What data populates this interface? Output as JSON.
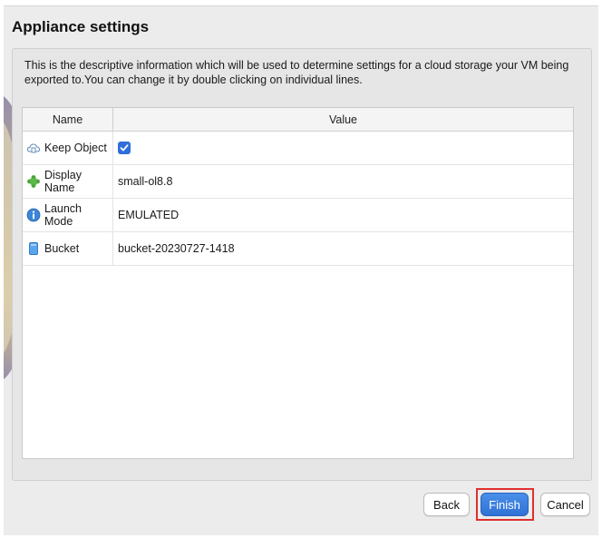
{
  "dialog": {
    "title": "Appliance settings",
    "description": "This is the descriptive information which will be used to determine settings for a cloud storage your VM being exported to.You can change it by double clicking on individual lines."
  },
  "table": {
    "columns": [
      "Name",
      "Value"
    ],
    "rows": [
      {
        "name": "Keep Object",
        "value": "",
        "icon": "cloud-object-icon",
        "checked": true
      },
      {
        "name": "Display Name",
        "value": "small-ol8.8",
        "icon": "puzzle-icon"
      },
      {
        "name": "Launch Mode",
        "value": "EMULATED",
        "icon": "info-icon"
      },
      {
        "name": "Bucket",
        "value": "bucket-20230727-1418",
        "icon": "bucket-icon"
      }
    ]
  },
  "buttons": {
    "back": "Back",
    "finish": "Finish",
    "cancel": "Cancel"
  },
  "colors": {
    "accent": "#2f72d6",
    "highlight": "#e0302f",
    "checkbox": "#2f6fd8"
  }
}
